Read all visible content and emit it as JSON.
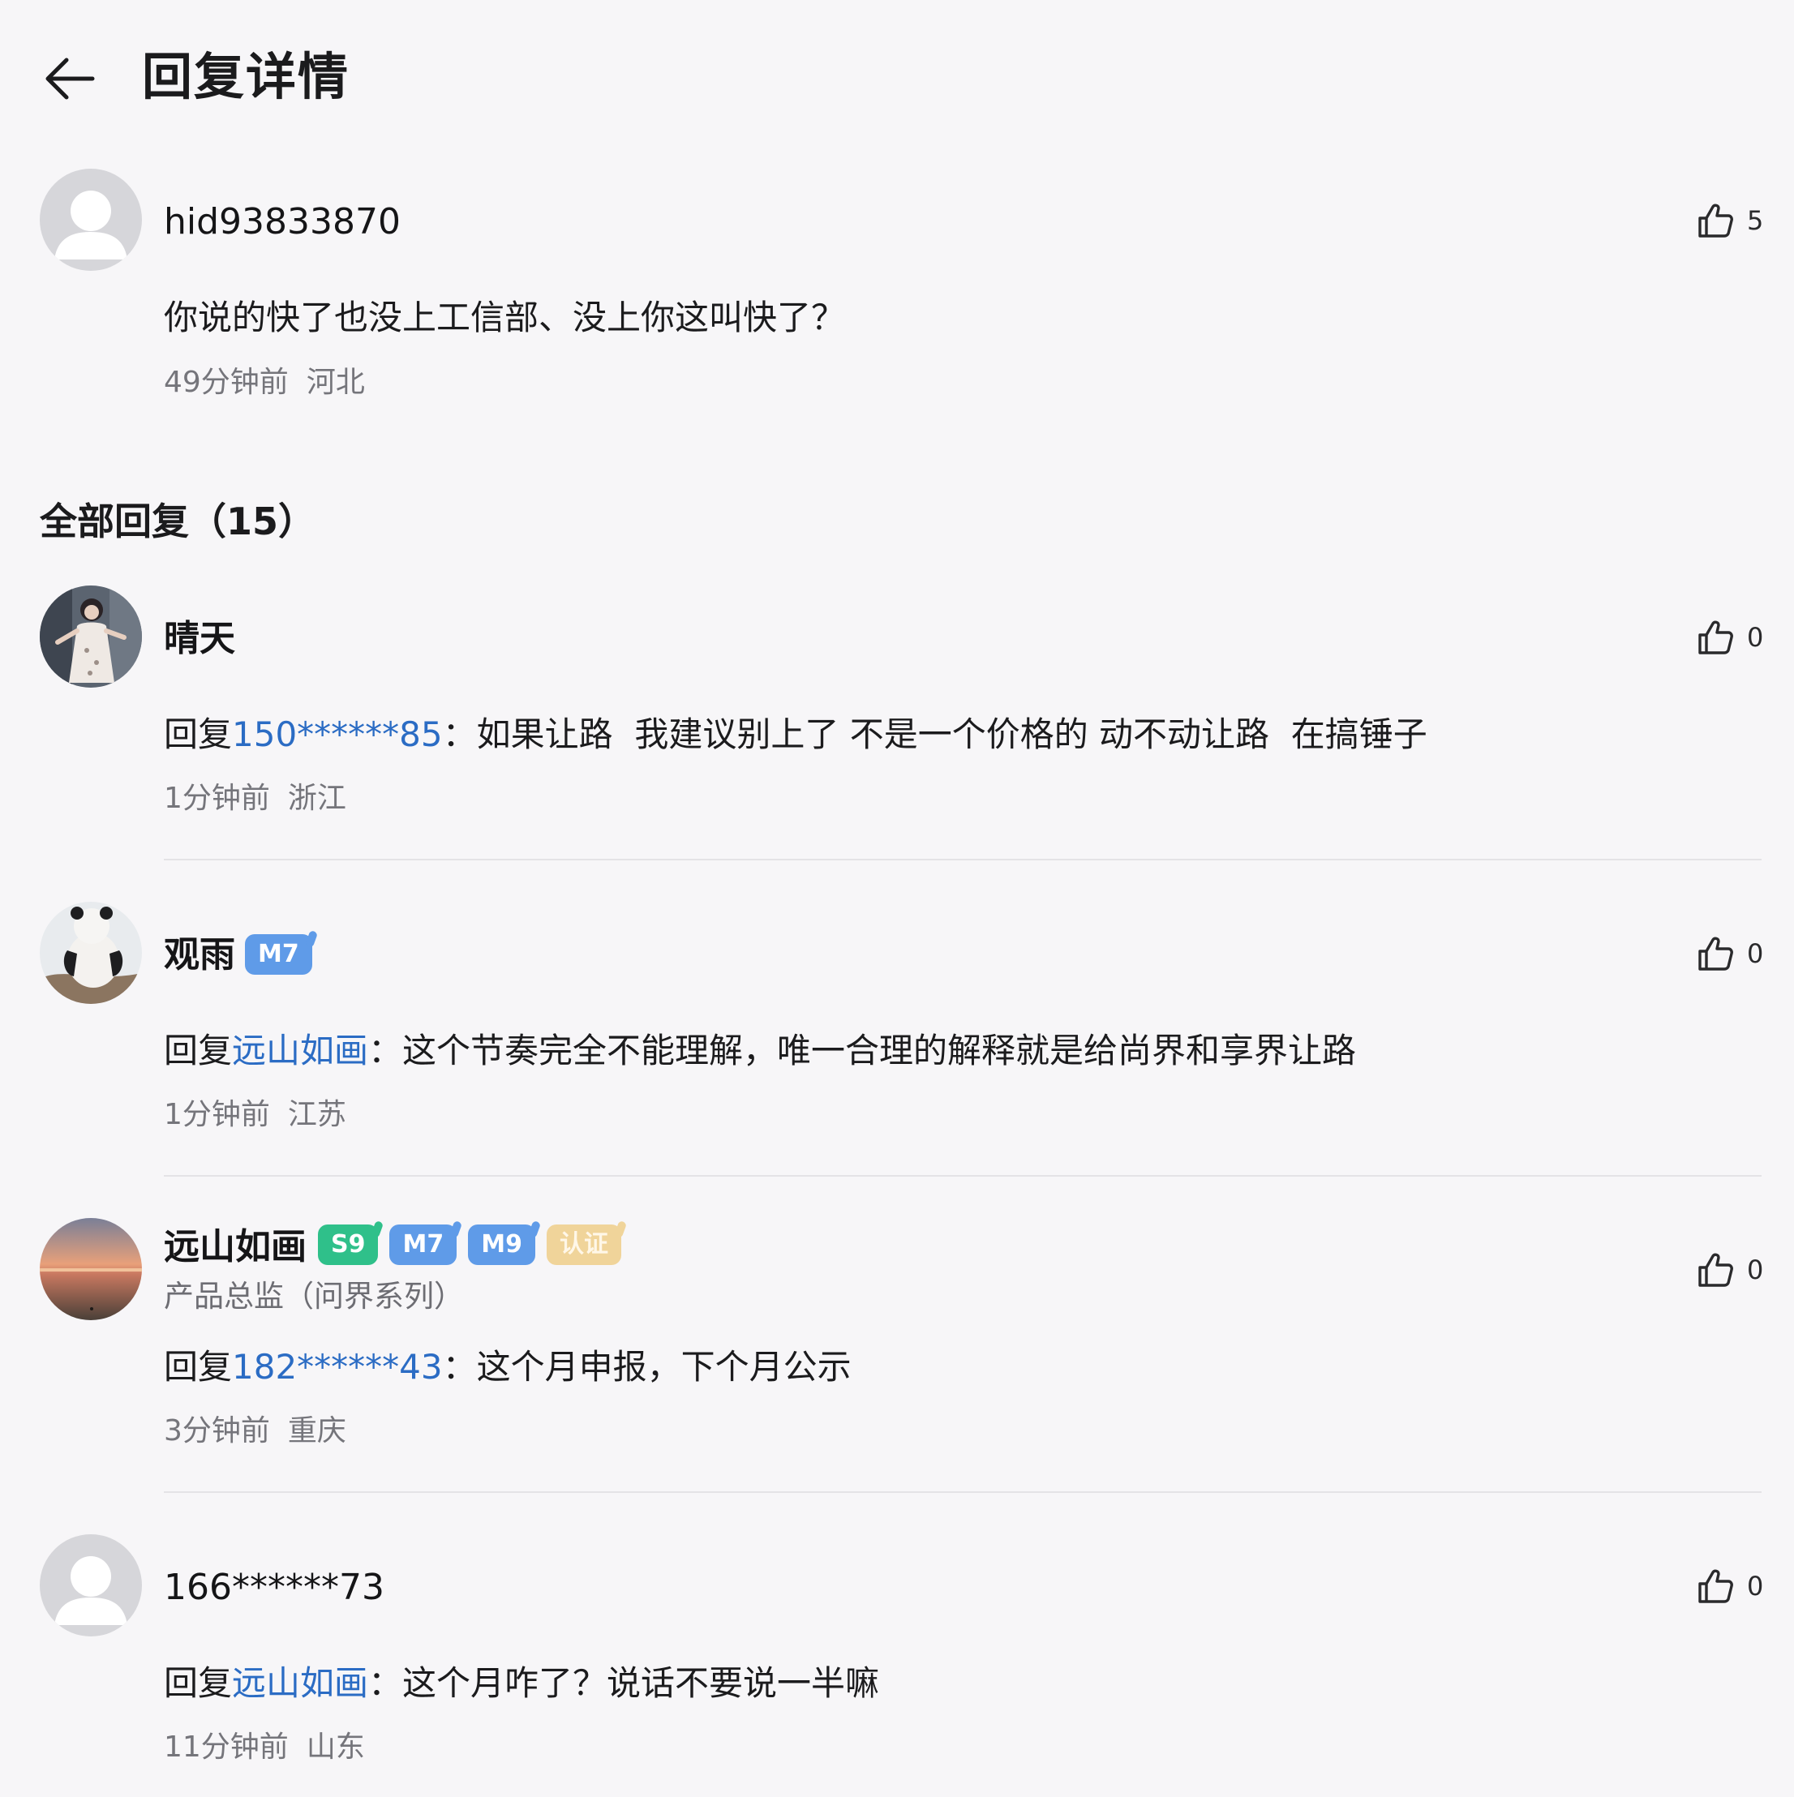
{
  "header": {
    "title": "回复详情"
  },
  "original": {
    "username": "hid93833870",
    "likes": "5",
    "content": "你说的快了也没上工信部、没上你这叫快了？",
    "time": "49分钟前",
    "location": "河北"
  },
  "section": {
    "title": "全部回复（15）"
  },
  "replies": [
    {
      "username": "晴天",
      "likes": "0",
      "reply_prefix": "回复",
      "reply_to": "150******85",
      "separator": "：",
      "text": "如果让路  我建议别上了 不是一个价格的 动不动让路  在搞锤子",
      "time": "1分钟前",
      "location": "浙江"
    },
    {
      "username": "观雨",
      "badges": [
        "M7"
      ],
      "likes": "0",
      "reply_prefix": "回复",
      "reply_to": "远山如画",
      "separator": "：",
      "text": "这个节奏完全不能理解，唯一合理的解释就是给尚界和享界让路",
      "time": "1分钟前",
      "location": "江苏"
    },
    {
      "username": "远山如画",
      "badges": [
        "S9",
        "M7",
        "M9",
        "认证"
      ],
      "subtitle": "产品总监（问界系列）",
      "likes": "0",
      "reply_prefix": "回复",
      "reply_to": "182******43",
      "separator": "：",
      "text": "这个月申报，下个月公示",
      "time": "3分钟前",
      "location": "重庆"
    },
    {
      "username": "166******73",
      "likes": "0",
      "reply_prefix": "回复",
      "reply_to": "远山如画",
      "separator": "：",
      "text": "这个月咋了？说话不要说一半嘛",
      "time": "11分钟前",
      "location": "山东"
    }
  ],
  "colors": {
    "background": "#f7f6f8",
    "link": "#2b6cc4",
    "badge_green": "#2fc08a",
    "badge_blue": "#5f9be8",
    "badge_gold": "#f0d49a"
  },
  "icons": {
    "back": "arrow-left-icon",
    "like": "thumbs-up-icon",
    "default_avatar": "person-silhouette-icon"
  }
}
